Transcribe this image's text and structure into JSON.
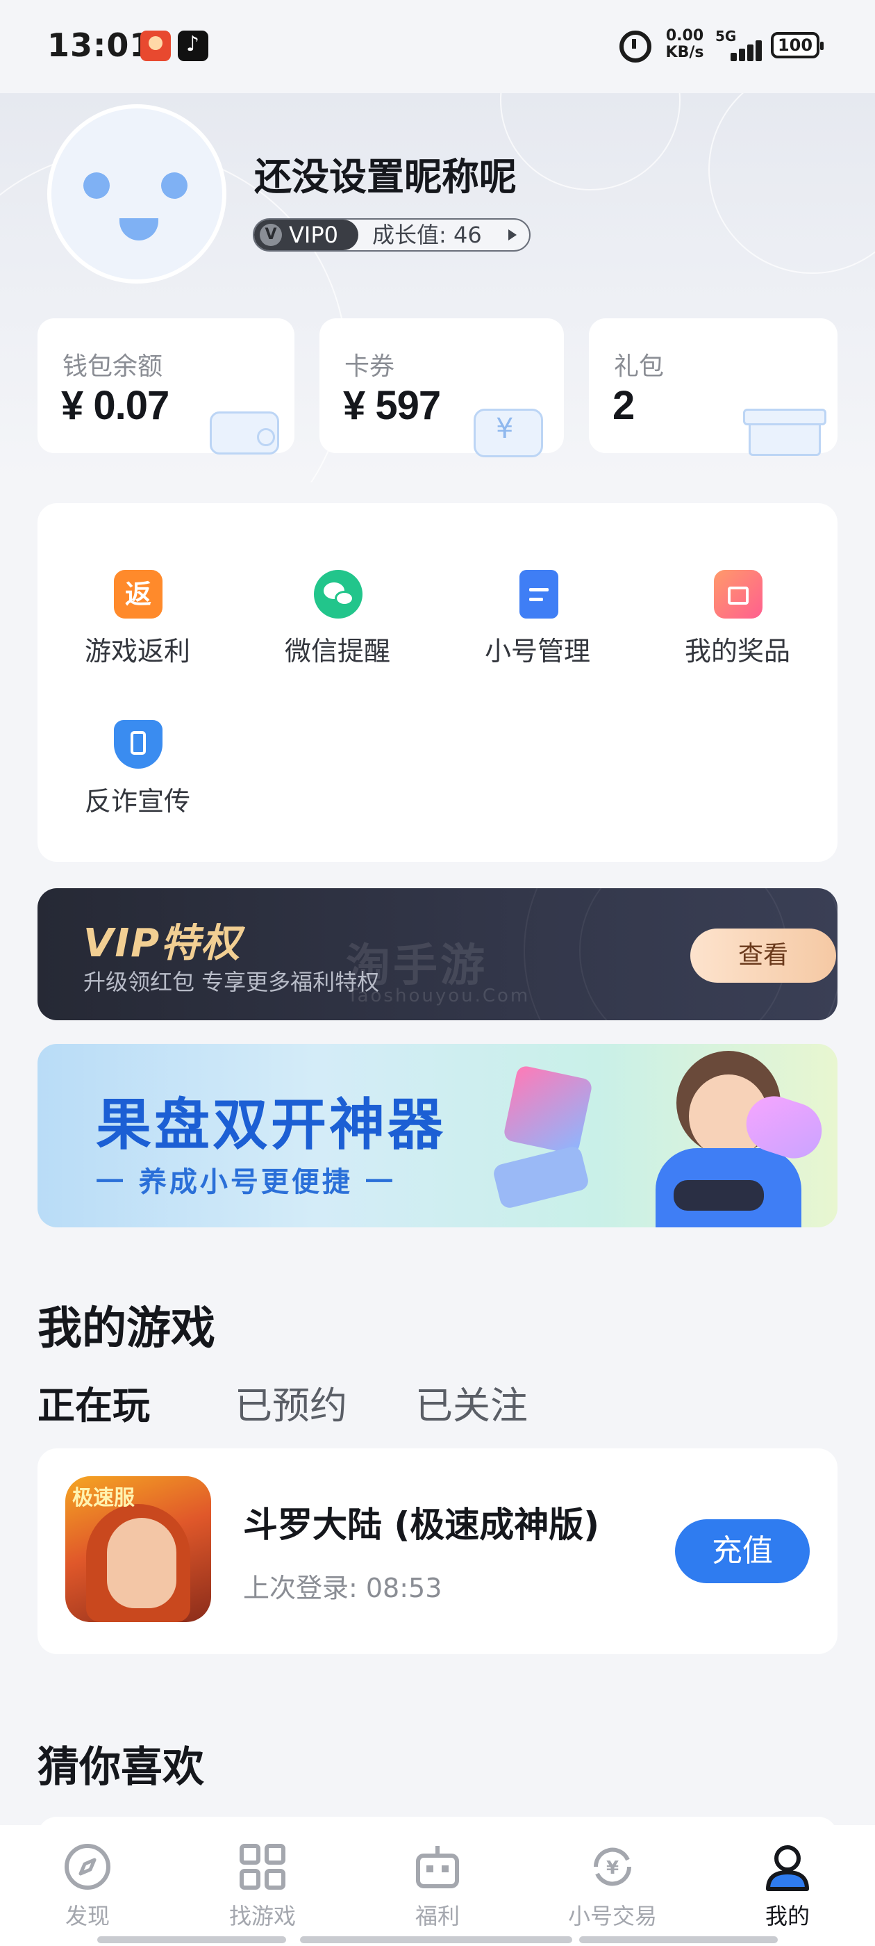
{
  "status_bar": {
    "time": "13:01",
    "net_speed_value": "0.00",
    "net_speed_unit": "KB/s",
    "network": "5G",
    "battery": "100"
  },
  "profile": {
    "nickname": "还没设置昵称呢",
    "vip_level": "VIP0",
    "vip_badge_letter": "V",
    "growth": "成长值: 46"
  },
  "wallet": [
    {
      "label": "钱包余额",
      "value": "¥ 0.07"
    },
    {
      "label": "卡券",
      "value": "¥ 597"
    },
    {
      "label": "礼包",
      "value": "2"
    }
  ],
  "functions": [
    {
      "label": "游戏返利",
      "icon": "rebate-icon",
      "icon_text": "返",
      "color": "#ff8a2b"
    },
    {
      "label": "微信提醒",
      "icon": "wechat-icon",
      "icon_text": "",
      "color": "#22c58b"
    },
    {
      "label": "小号管理",
      "icon": "clipboard-icon",
      "icon_text": "",
      "color": "#3f7ef5"
    },
    {
      "label": "我的奖品",
      "icon": "gift-icon",
      "icon_text": "",
      "color": "#ff7a8a"
    },
    {
      "label": "反诈宣传",
      "icon": "shield-phone-icon",
      "icon_text": "",
      "color": "#3a8cf0"
    }
  ],
  "vip_banner": {
    "title": "VIP特权",
    "subtitle": "升级领红包 专享更多福利特权",
    "button": "查看",
    "watermark": "淘手游",
    "watermark_sub": "Taoshouyou.Com"
  },
  "promo_banner": {
    "title": "果盘双开神器",
    "subtitle": "一 养成小号更便捷 一"
  },
  "my_games": {
    "title": "我的游戏",
    "tabs": [
      "正在玩",
      "已预约",
      "已关注"
    ],
    "active_tab": 0,
    "game": {
      "name": "斗罗大陆 (极速成神版)",
      "icon_tag": "极速服",
      "last_login": "上次登录: 08:53",
      "button": "充值"
    }
  },
  "guess": {
    "title": "猜你喜欢"
  },
  "bottom_nav": [
    {
      "label": "发现",
      "icon": "compass-icon"
    },
    {
      "label": "找游戏",
      "icon": "grid-icon"
    },
    {
      "label": "福利",
      "icon": "robot-icon"
    },
    {
      "label": "小号交易",
      "icon": "exchange-icon"
    },
    {
      "label": "我的",
      "icon": "user-icon"
    }
  ],
  "colors": {
    "accent": "#2f7cf0",
    "vip_gold": "#f2cf93",
    "background": "#f4f5f8"
  }
}
